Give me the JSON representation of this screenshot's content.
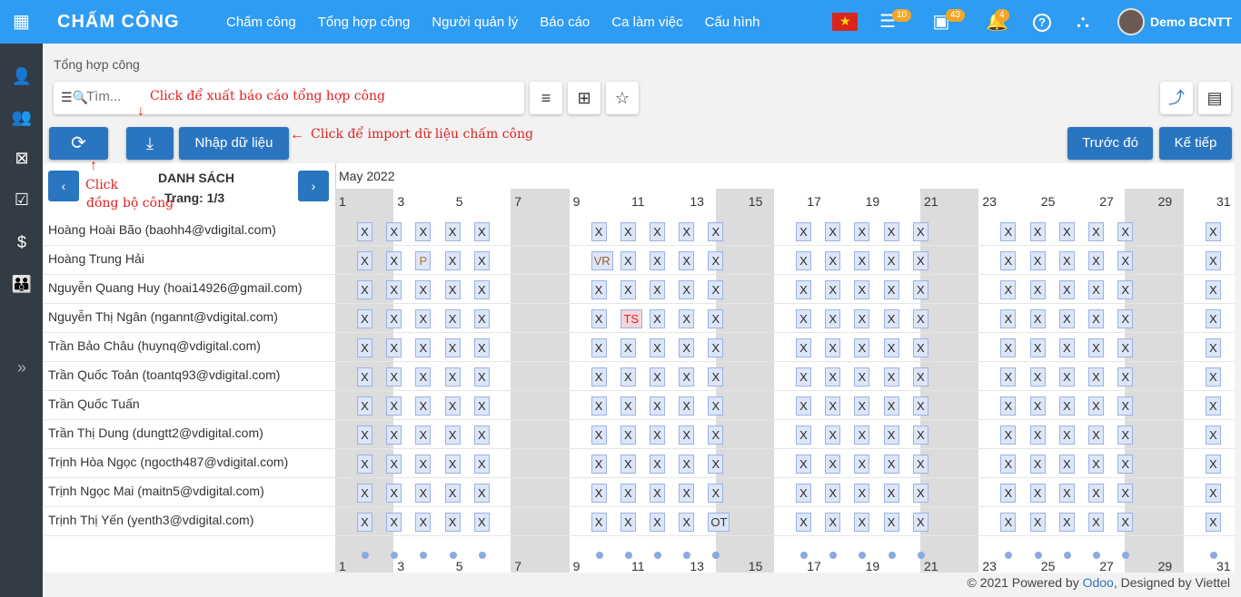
{
  "app": {
    "title": "CHẤM CÔNG"
  },
  "menu": [
    "Chấm công",
    "Tổng hợp công",
    "Người quản lý",
    "Báo cáo",
    "Ca làm việc",
    "Cấu hình"
  ],
  "badges": {
    "tasks": "10",
    "calendar": "43",
    "notifications": "4"
  },
  "user": {
    "name": "Demo BCNTT"
  },
  "breadcrumb": "Tổng hợp công",
  "search": {
    "placeholder": "Tìm..."
  },
  "buttons": {
    "import": "Nhập dữ liệu",
    "prev": "Trước đó",
    "next": "Kế tiếp"
  },
  "notes": {
    "export": "Click để xuất báo cáo tổng hợp công",
    "import": "Click để import dữ liệu chấm công",
    "sync_line1": "Click",
    "sync_line2": "đồng bộ công"
  },
  "list": {
    "title": "DANH SÁCH",
    "page": "Trang: 1/3"
  },
  "calendar": {
    "month": "May 2022",
    "day_labels": [
      "1",
      "3",
      "5",
      "7",
      "9",
      "11",
      "13",
      "15",
      "17",
      "19",
      "21",
      "23",
      "25",
      "27",
      "29",
      "31"
    ],
    "employees": [
      {
        "name": "Hoàng Hoài Bão (baohh4@vdigital.com)",
        "special": {}
      },
      {
        "name": "Hoàng Trung Hải",
        "special": {
          "3": "P",
          "9": "VR"
        }
      },
      {
        "name": "Nguyễn Quang Huy (hoai14926@gmail.com)",
        "special": {}
      },
      {
        "name": "Nguyễn Thị Ngân (ngannt@vdigital.com)",
        "special": {
          "10": "TS"
        }
      },
      {
        "name": "Trần Bảo Châu (huynq@vdigital.com)",
        "special": {}
      },
      {
        "name": "Trần Quốc Toản (toantq93@vdigital.com)",
        "special": {}
      },
      {
        "name": "Trần Quốc Tuấn",
        "special": {}
      },
      {
        "name": "Trần Thị Dung (dungtt2@vdigital.com)",
        "special": {}
      },
      {
        "name": "Trịnh Hòa Ngọc (ngocth487@vdigital.com)",
        "special": {}
      },
      {
        "name": "Trịnh Ngọc Mai (maitn5@vdigital.com)",
        "special": {}
      },
      {
        "name": "Trịnh Thị Yến (yenth3@vdigital.com)",
        "special": {
          "13": "OT"
        }
      }
    ],
    "work_days": [
      1,
      2,
      3,
      4,
      5,
      9,
      10,
      11,
      12,
      13,
      16,
      17,
      18,
      19,
      20,
      23,
      24,
      25,
      26,
      27,
      30,
      31
    ],
    "default_mark": "X"
  },
  "footer": {
    "prefix": "© 2021 Powered by ",
    "odoo": "Odoo",
    "suffix": ", Designed by Viettel"
  }
}
